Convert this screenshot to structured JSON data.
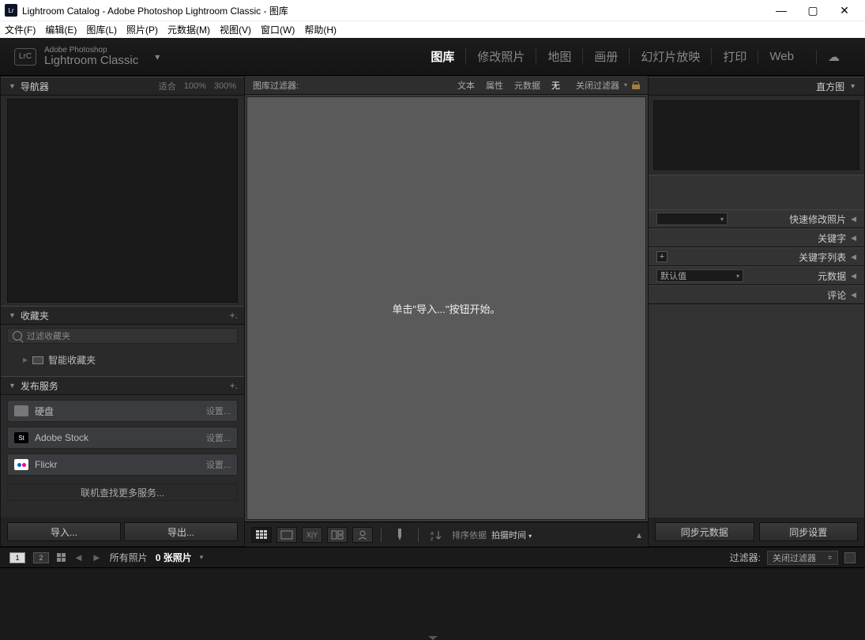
{
  "window": {
    "title": "Lightroom Catalog - Adobe Photoshop Lightroom Classic - 图库"
  },
  "menubar": [
    "文件(F)",
    "编辑(E)",
    "图库(L)",
    "照片(P)",
    "元数据(M)",
    "视图(V)",
    "窗口(W)",
    "帮助(H)"
  ],
  "branding": {
    "logo_short": "LrC",
    "line1": "Adobe Photoshop",
    "line2": "Lightroom Classic"
  },
  "modules": [
    "图库",
    "修改照片",
    "地图",
    "画册",
    "幻灯片放映",
    "打印",
    "Web"
  ],
  "left": {
    "navigator": {
      "title": "导航器",
      "fit": "适合",
      "z100": "100%",
      "z300": "300%"
    },
    "collections": {
      "title": "收藏夹",
      "filter_placeholder": "过滤收藏夹",
      "smart": "智能收藏夹"
    },
    "publish": {
      "title": "发布服务",
      "items": [
        {
          "name": "硬盘",
          "action": "设置..."
        },
        {
          "name": "Adobe Stock",
          "action": "设置..."
        },
        {
          "name": "Flickr",
          "action": "设置..."
        }
      ],
      "more": "联机查找更多服务..."
    },
    "import_btn": "导入...",
    "export_btn": "导出..."
  },
  "center": {
    "filter_label": "图库过滤器:",
    "filters": {
      "text": "文本",
      "attr": "属性",
      "meta": "元数据",
      "none": "无"
    },
    "close_filter": "关闭过滤器",
    "empty_msg": "单击\"导入...\"按钮开始。",
    "sort_label": "排序依据",
    "sort_value": "拍摄时间"
  },
  "right": {
    "histogram": "直方图",
    "quick_dev": "快速修改照片",
    "keywords": "关键字",
    "keyword_list": "关键字列表",
    "metadata": "元数据",
    "metadata_preset": "默认值",
    "comments": "评论",
    "sync_meta": "同步元数据",
    "sync_settings": "同步设置"
  },
  "footer": {
    "all_photos": "所有照片",
    "count": "0 张照片",
    "filter_label": "过滤器:",
    "filter_value": "关闭过滤器"
  }
}
